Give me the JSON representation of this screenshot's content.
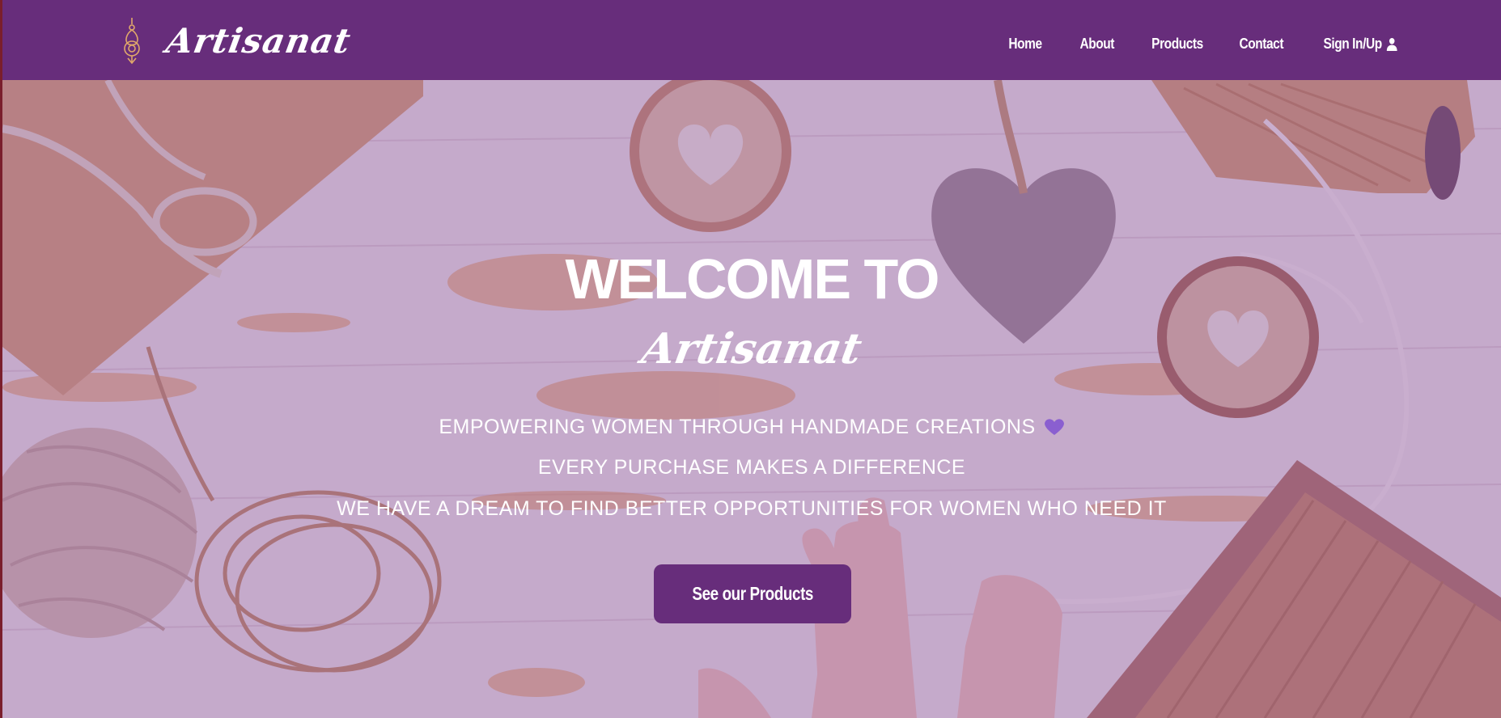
{
  "brand": {
    "name": "Artisanat"
  },
  "nav": {
    "items": [
      {
        "label": "Home"
      },
      {
        "label": "About"
      },
      {
        "label": "Products"
      },
      {
        "label": "Contact"
      },
      {
        "label": "Sign In/Up",
        "icon": "user-icon"
      }
    ]
  },
  "hero": {
    "welcome": "WELCOME TO",
    "brand": "Artisanat",
    "tagline_1": "EMPOWERING WOMEN THROUGH HANDMADE CREATIONS",
    "tagline_1_icon": "heart-icon",
    "tagline_2": "EVERY PURCHASE MAKES A DIFFERENCE",
    "tagline_3": "WE HAVE A DREAM TO FIND BETTER OPPORTUNITIES FOR WOMEN WHO NEED IT",
    "cta_label": "See our Products"
  },
  "colors": {
    "primary": "#672d7b",
    "overlay": "#8a4696",
    "heart": "#8a5fd0",
    "text_light": "#ffffff"
  }
}
